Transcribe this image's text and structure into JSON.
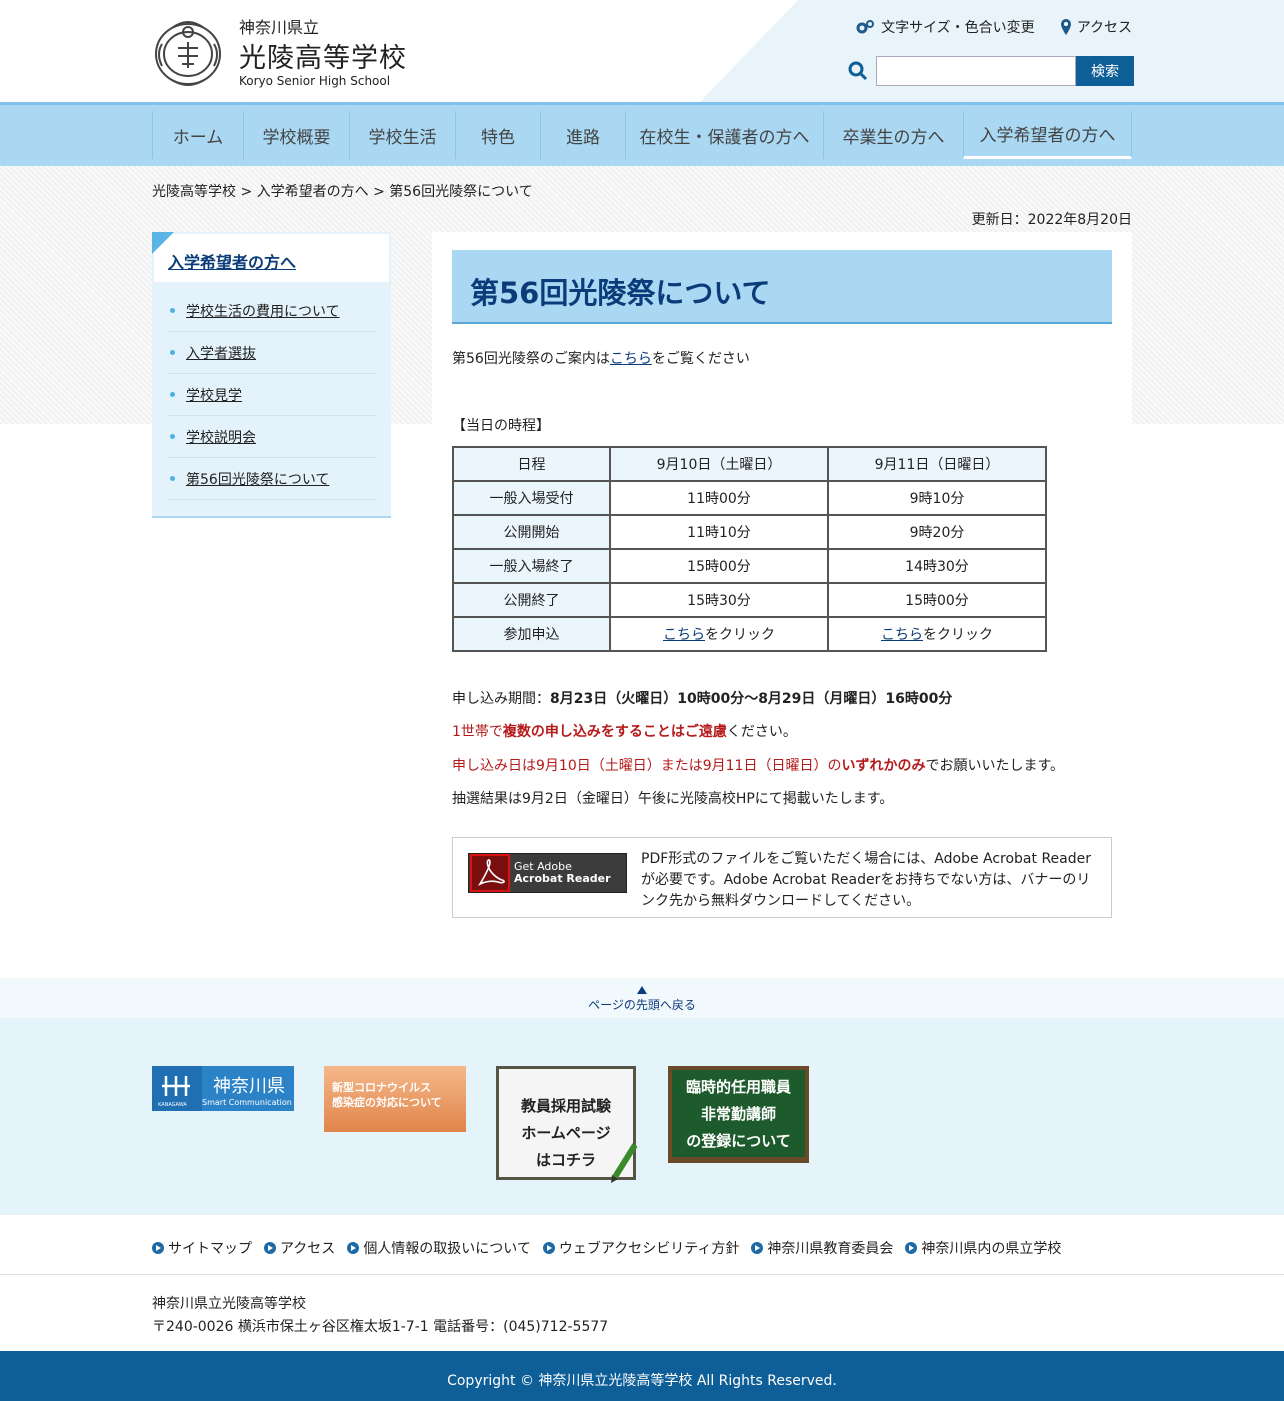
{
  "header": {
    "pref": "神奈川県立",
    "school_name": "光陵高等学校",
    "school_en": "Koryo Senior High School",
    "tools": {
      "fontsize_label": "文字サイズ・色合い変更",
      "access_label": "アクセス"
    },
    "search": {
      "button_label": "検索",
      "placeholder": ""
    }
  },
  "nav": {
    "items": [
      {
        "label": "ホーム"
      },
      {
        "label": "学校概要"
      },
      {
        "label": "学校生活"
      },
      {
        "label": "特色"
      },
      {
        "label": "進路"
      },
      {
        "label": "在校生・保護者の方へ"
      },
      {
        "label": "卒業生の方へ"
      },
      {
        "label": "入学希望者の方へ"
      }
    ]
  },
  "breadcrumb": "光陵高等学校 > 入学希望者の方へ > 第56回光陵祭について",
  "updated": "更新日：2022年8月20日",
  "sidebar": {
    "title": "入学希望者の方へ",
    "items": [
      {
        "label": "学校生活の費用について"
      },
      {
        "label": "入学者選抜"
      },
      {
        "label": "学校見学"
      },
      {
        "label": "学校説明会"
      },
      {
        "label": "第56回光陵祭について"
      }
    ]
  },
  "main": {
    "title": "第56回光陵祭について",
    "intro_pre": "第56回光陵祭のご案内は",
    "intro_link": "こちら",
    "intro_post": "をご覧ください",
    "schedule_title": "【当日の時程】",
    "table": {
      "headers": [
        "日程",
        "9月10日（土曜日）",
        "9月11日（日曜日）"
      ],
      "rows": [
        [
          "一般入場受付",
          "11時00分",
          "9時10分"
        ],
        [
          "公開開始",
          "11時10分",
          "9時20分"
        ],
        [
          "一般入場終了",
          "15時00分",
          "14時30分"
        ],
        [
          "公開終了",
          "15時30分",
          "15時00分"
        ]
      ],
      "signup_label": "参加申込",
      "signup_link": "こちら",
      "signup_suffix": "をクリック"
    },
    "period_label": "申し込み期間：",
    "period_value": "8月23日（火曜日）10時00分～8月29日（月曜日）16時00分",
    "note1_a": "1世帯で",
    "note1_b": "複数の申し込みをすることはご遠慮",
    "note1_c": "ください。",
    "note2_a": "申し込み日は9月10日（土曜日）または9月11日（日曜日）の",
    "note2_b": "いずれかのみ",
    "note2_c": "でお願いいたします。",
    "note3": "抽選結果は9月2日（金曜日）午後に光陵高校HPにて掲載いたします。",
    "pdf_banner_line1": "Get Adobe",
    "pdf_banner_line2": "Acrobat Reader",
    "pdf_text": "PDF形式のファイルをご覧いただく場合には、Adobe Acrobat Readerが必要です。Adobe Acrobat Readerをお持ちでない方は、バナーのリンク先から無料ダウンロードしてください。"
  },
  "totop": "ページの先頭へ戻る",
  "banners": {
    "kanagawa": "神奈川県",
    "kanagawa_sub": "Smart Communication",
    "kanagawa_small": "KANAGAWA",
    "corona_line1": "新型コロナウイルス",
    "corona_line2": "感染症の対応について",
    "teacher_line1": "教員採用試験",
    "teacher_line2": "ホームページ",
    "teacher_line3": "はコチラ",
    "temp_line1": "臨時的任用職員",
    "temp_line2": "非常勤講師",
    "temp_line3": "の登録について"
  },
  "footer": {
    "links": [
      {
        "label": "サイトマップ"
      },
      {
        "label": "アクセス"
      },
      {
        "label": "個人情報の取扱いについて"
      },
      {
        "label": "ウェブアクセシビリティ方針"
      },
      {
        "label": "神奈川県教育委員会"
      },
      {
        "label": "神奈川県内の県立学校"
      }
    ],
    "address_name": "神奈川県立光陵高等学校",
    "address_line": "〒240-0026 横浜市保土ヶ谷区権太坂1-7-1 電話番号：(045)712-5577",
    "copyright": "Copyright © 神奈川県立光陵高等学校 All Rights Reserved."
  },
  "colors": {
    "accent": "#0e5e97",
    "nav_bg": "#aad8f3",
    "alert_red": "#b51a1a"
  }
}
